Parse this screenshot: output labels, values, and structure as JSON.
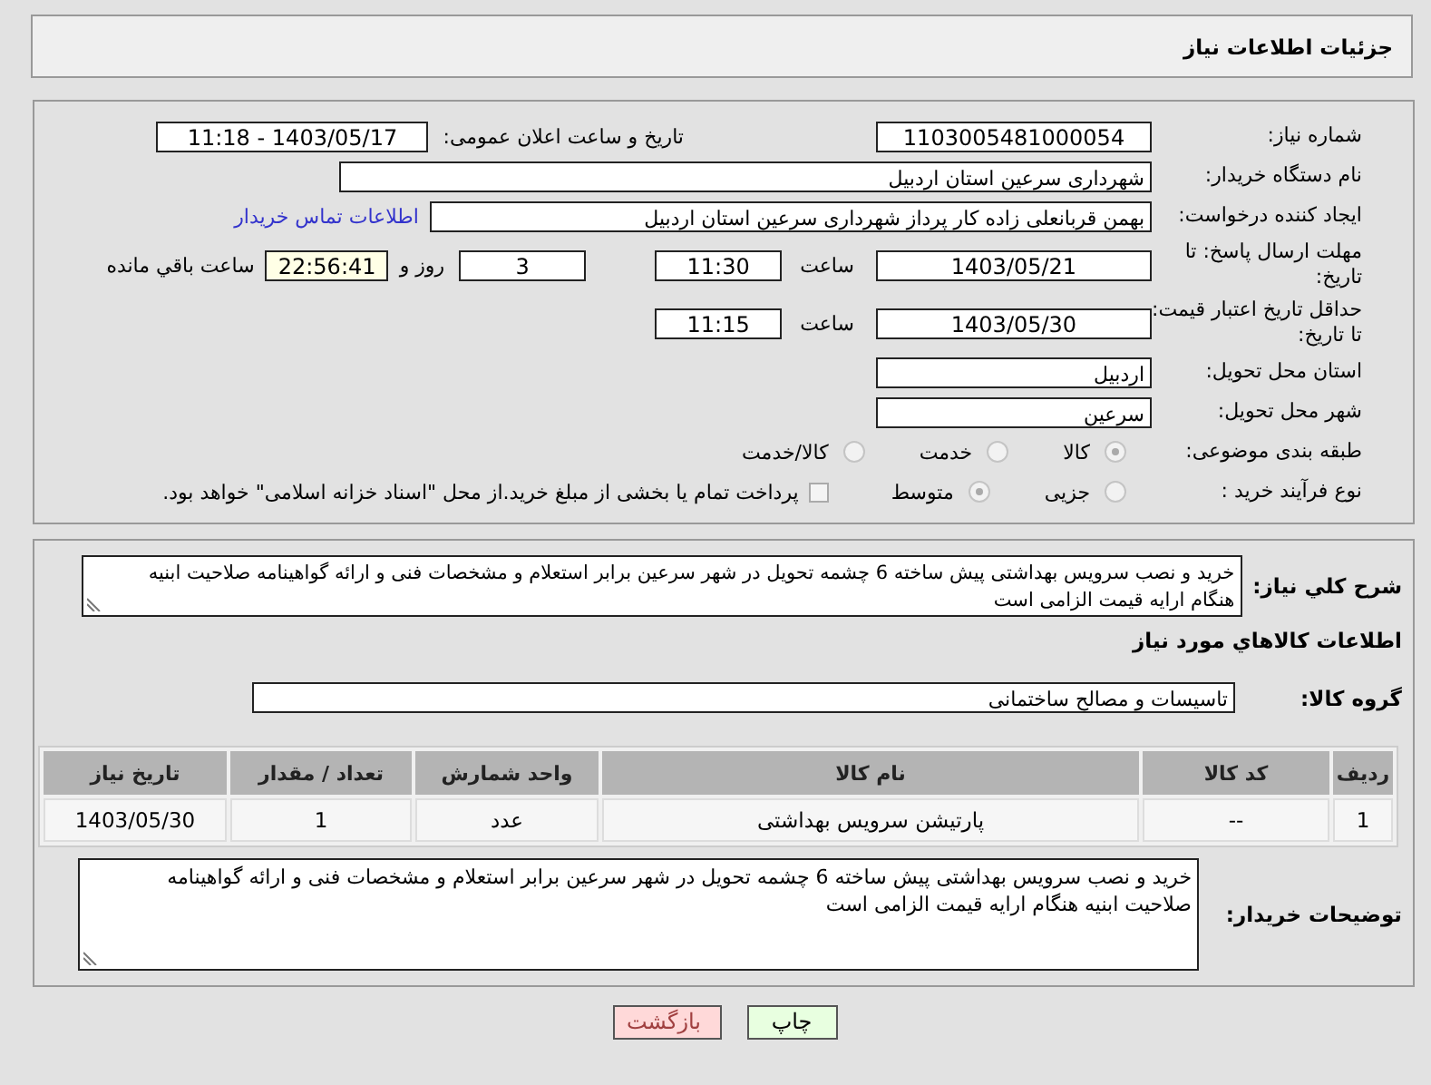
{
  "page_title": "جزئیات اطلاعات نیاز",
  "need_number": {
    "label": "شماره نیاز:",
    "value": "1103005481000054"
  },
  "announce": {
    "label": "تاریخ و ساعت اعلان عمومی:",
    "value": "1403/05/17 - 11:18"
  },
  "buyer_org": {
    "label": "نام دستگاه خریدار:",
    "value": "شهرداری سرعین استان اردبیل"
  },
  "requester": {
    "label": "ایجاد کننده درخواست:",
    "value": "بهمن قربانعلی زاده کار پرداز شهرداری سرعین استان اردبیل",
    "link": "اطلاعات تماس خریدار"
  },
  "reply_deadline": {
    "label": "مهلت ارسال پاسخ: تا تاریخ:",
    "date": "1403/05/21",
    "time_label": "ساعت",
    "time": "11:30",
    "days": "3",
    "days_label": "روز و",
    "remaining": "22:56:41",
    "remaining_label": "ساعت باقي مانده"
  },
  "price_validity": {
    "label": "حداقل تاریخ اعتبار قیمت: تا تاریخ:",
    "date": "1403/05/30",
    "time_label": "ساعت",
    "time": "11:15"
  },
  "province": {
    "label": "استان محل تحویل:",
    "value": "اردبیل"
  },
  "city": {
    "label": "شهر محل تحویل:",
    "value": "سرعین"
  },
  "category": {
    "label": "طبقه بندی موضوعی:",
    "options": [
      {
        "label": "کالا",
        "selected": true
      },
      {
        "label": "خدمت",
        "selected": false
      },
      {
        "label": "کالا/خدمت",
        "selected": false
      }
    ]
  },
  "process": {
    "label": "نوع فرآیند خرید :",
    "options": [
      {
        "label": "جزیی",
        "selected": false
      },
      {
        "label": "متوسط",
        "selected": true
      }
    ],
    "payment": {
      "checked": false,
      "text": "پرداخت تمام یا بخشی از مبلغ خرید.از محل \"اسناد خزانه اسلامی\" خواهد بود."
    }
  },
  "description": {
    "label": "شرح کلي نياز:",
    "value": "خرید و نصب سرویس بهداشتی پیش ساخته 6 چشمه تحویل در شهر سرعین برابر استعلام و مشخصات فنی و ارائه گواهینامه صلاحیت ابنیه هنگام ارایه قیمت الزامی است"
  },
  "goods_heading": "اطلاعات کالاهاي مورد نياز",
  "goods_group": {
    "label": "گروه کالا:",
    "value": "تاسیسات و مصالح ساختمانی"
  },
  "table": {
    "columns": [
      "ردیف",
      "کد کالا",
      "نام کالا",
      "واحد شمارش",
      "تعداد / مقدار",
      "تاریخ نیاز"
    ],
    "rows": [
      [
        "1",
        "--",
        "پارتیشن سرویس بهداشتی",
        "عدد",
        "1",
        "1403/05/30"
      ]
    ]
  },
  "buyer_notes": {
    "label": "توضیحات خریدار:",
    "value": "خرید و نصب سرویس بهداشتی پیش ساخته 6 چشمه تحویل در شهر سرعین برابر استعلام و مشخصات فنی و ارائه گواهینامه صلاحیت ابنیه هنگام ارایه قیمت الزامی است"
  },
  "buttons": [
    {
      "kind": "print",
      "label": "چاپ"
    },
    {
      "kind": "back",
      "label": "بازگشت"
    }
  ]
}
